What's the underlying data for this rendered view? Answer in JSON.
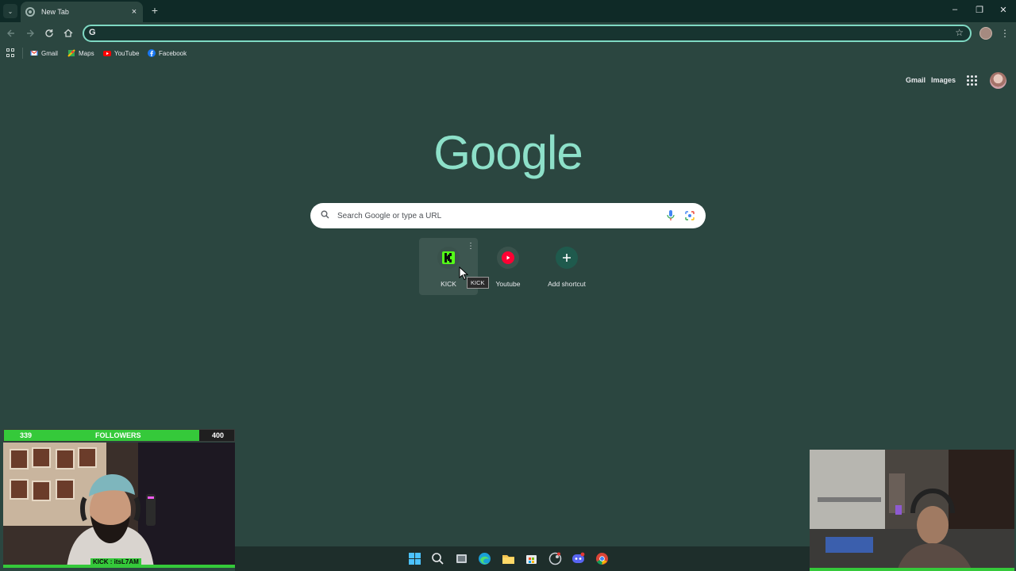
{
  "browser": {
    "tab": {
      "title": "New Tab",
      "close": "×"
    },
    "new_tab": "+",
    "window_controls": {
      "minimize": "–",
      "restore": "❐",
      "close": "✕"
    },
    "omnibox": {
      "value": "",
      "prefix": "G"
    }
  },
  "bookmarks": [
    {
      "label": "Gmail",
      "icon": "gmail-icon",
      "color": "#ea4335"
    },
    {
      "label": "Maps",
      "icon": "maps-icon",
      "color": "#34a853"
    },
    {
      "label": "YouTube",
      "icon": "youtube-icon",
      "color": "#ff0000"
    },
    {
      "label": "Facebook",
      "icon": "facebook-icon",
      "color": "#1877f2"
    }
  ],
  "ntp": {
    "top_links": {
      "gmail": "Gmail",
      "images": "Images"
    },
    "logo": "Google",
    "search_placeholder": "Search Google or type a URL",
    "shortcuts": [
      {
        "label": "KICK",
        "icon": "kick-icon",
        "color": "#53fc18"
      },
      {
        "label": "Youtube",
        "icon": "youtube-icon",
        "color": "#ff0033"
      },
      {
        "label": "Add shortcut",
        "icon": "plus-icon",
        "color": "#ffffff"
      }
    ],
    "tooltip": "KICK"
  },
  "overlay": {
    "followers_current": "339",
    "followers_label": "FOLLOWERS",
    "followers_goal": "400",
    "followers_progress": 0.8475,
    "webcam_tag": "KICK : itsL7AM"
  },
  "taskbar": {
    "icons": [
      "windows-start-icon",
      "search-icon",
      "task-view-icon",
      "edge-icon",
      "file-explorer-icon",
      "store-icon",
      "steam-icon",
      "discord-icon",
      "chrome-icon"
    ]
  },
  "colors": {
    "accent": "#7fd9c3",
    "background": "#2b4640",
    "logo": "#8de0c9",
    "overlay_green": "#35c93a"
  }
}
